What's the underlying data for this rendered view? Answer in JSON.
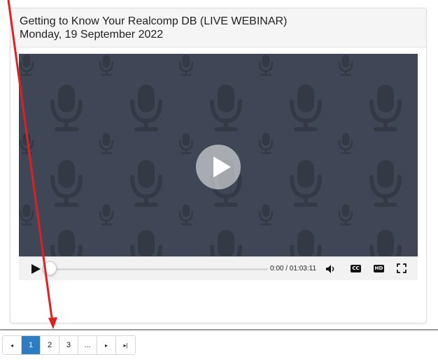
{
  "webinar": {
    "title": "Getting to Know Your Realcomp DB (LIVE WEBINAR)",
    "date": "Monday, 19 September 2022"
  },
  "player": {
    "background_icon": "microphone-icon",
    "play_icon": "play-icon",
    "time_display": "0:00 / 01:03:11",
    "progress_fraction": 0,
    "cc_label": "CC",
    "hd_label": "HD",
    "colors": {
      "screen": "#3f4756",
      "pattern": "#333a46",
      "control_bar": "#f2f2f2"
    }
  },
  "pagination": {
    "first_icon": "◂",
    "pages": [
      "1",
      "2",
      "3",
      "..."
    ],
    "active_page": "1",
    "next_icon": "▸",
    "last_icon": "▸|",
    "active_color": "#2d7dc2"
  },
  "annotation": {
    "arrow_color": "#e02020"
  }
}
